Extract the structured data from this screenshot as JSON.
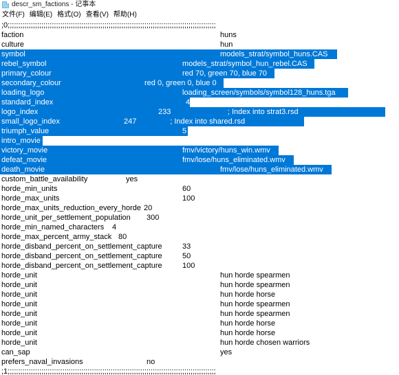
{
  "window": {
    "title": "descr_sm_factions - 记事本",
    "icon": "notepad-icon"
  },
  "menubar": {
    "items": [
      {
        "label": "文件(F)",
        "name": "file"
      },
      {
        "label": "编辑(E)",
        "name": "edit"
      },
      {
        "label": "格式(O)",
        "name": "format"
      },
      {
        "label": "查看(V)",
        "name": "view"
      },
      {
        "label": "帮助(H)",
        "name": "help"
      }
    ]
  },
  "editor": {
    "selection_color": "#0078d7",
    "selection_text_color": "#ffffff",
    "text_color": "#000000",
    "background_color": "#ffffff",
    "lines": [
      {
        "key": ";0;;;;;;;;;;;;;;;;;;;;;;;;;;;;;;;;;;;;;;;;;;;;;;;;;;;;;;;;;;;;;;;;;;;;;;;;;;;;;;;;;;;;;;;;;;;;;;;;;;;",
        "val": "",
        "valx": 0,
        "selected": false,
        "selw": 0,
        "comment": true
      },
      {
        "key": "faction",
        "val": "huns",
        "valx": 320,
        "selected": false,
        "selw": 0
      },
      {
        "key": "culture",
        "val": "hun",
        "valx": 320,
        "selected": false,
        "selw": 0
      },
      {
        "key": "symbol",
        "val": "models_strat/symbol_huns.CAS",
        "valx": 320,
        "selected": true,
        "selw": 490
      },
      {
        "key": "rebel_symbol",
        "val": "models_strat/symbol_hun_rebel.CAS",
        "valx": 265,
        "selected": true,
        "selw": 457
      },
      {
        "key": "primary_colour",
        "val": "red 70, green 70, blue 70",
        "valx": 265,
        "selected": true,
        "selw": 399
      },
      {
        "key": "secondary_colour",
        "val": "red 0, green 0, blue 0",
        "valx": 210,
        "selected": true,
        "selw": 325
      },
      {
        "key": "loading_logo",
        "val": "loading_screen/symbols/symbol128_huns.tga",
        "valx": 265,
        "selected": true,
        "selw": 506
      },
      {
        "key": "standard_index",
        "val": "4",
        "valx": 270,
        "selected": true,
        "selw": 276
      },
      {
        "key": "logo_index",
        "val": "233                           ; Index into strat3.rsd",
        "valx": 230,
        "selected": true,
        "selw": 560
      },
      {
        "key": "small_logo_index",
        "val": "247                ; Index into shared.rsd",
        "valx": 180,
        "selected": true,
        "selw": 442
      },
      {
        "key": "triumph_value",
        "val": "5",
        "valx": 265,
        "selected": true,
        "selw": 273
      },
      {
        "key": "intro_movie",
        "val": "",
        "valx": 0,
        "selected": true,
        "selw": 62
      },
      {
        "key": "victory_movie",
        "val": "fmv/victory/huns_win.wmv",
        "valx": 265,
        "selected": true,
        "selw": 405
      },
      {
        "key": "defeat_movie",
        "val": "fmv/lose/huns_eliminated.wmv",
        "valx": 265,
        "selected": true,
        "selw": 427
      },
      {
        "key": "death_movie",
        "val": "fmv/lose/huns_eliminated.wmv",
        "valx": 320,
        "selected": true,
        "selw": 482
      },
      {
        "key": "custom_battle_availability",
        "val": "yes",
        "valx": 183,
        "selected": false,
        "selw": 0
      },
      {
        "key": "horde_min_units",
        "val": "60",
        "valx": 265,
        "selected": false,
        "selw": 0
      },
      {
        "key": "horde_max_units",
        "val": "100",
        "valx": 265,
        "selected": false,
        "selw": 0
      },
      {
        "key": "horde_max_units_reduction_every_horde",
        "val": "20",
        "valx": 209,
        "selected": false,
        "selw": 0
      },
      {
        "key": "horde_unit_per_settlement_population",
        "val": "300",
        "valx": 213,
        "selected": false,
        "selw": 0
      },
      {
        "key": "horde_min_named_characters",
        "val": "4",
        "valx": 163,
        "selected": false,
        "selw": 0
      },
      {
        "key": "horde_max_percent_army_stack",
        "val": "80",
        "valx": 172,
        "selected": false,
        "selw": 0
      },
      {
        "key": "horde_disband_percent_on_settlement_capture",
        "val": "33",
        "valx": 265,
        "selected": false,
        "selw": 0
      },
      {
        "key": "horde_disband_percent_on_settlement_capture",
        "val": "50",
        "valx": 265,
        "selected": false,
        "selw": 0
      },
      {
        "key": "horde_disband_percent_on_settlement_capture",
        "val": "100",
        "valx": 265,
        "selected": false,
        "selw": 0
      },
      {
        "key": "horde_unit",
        "val": "hun horde spearmen",
        "valx": 320,
        "selected": false,
        "selw": 0
      },
      {
        "key": "horde_unit",
        "val": "hun horde spearmen",
        "valx": 320,
        "selected": false,
        "selw": 0
      },
      {
        "key": "horde_unit",
        "val": "hun horde horse",
        "valx": 320,
        "selected": false,
        "selw": 0
      },
      {
        "key": "horde_unit",
        "val": "hun horde spearmen",
        "valx": 320,
        "selected": false,
        "selw": 0
      },
      {
        "key": "horde_unit",
        "val": "hun horde spearmen",
        "valx": 320,
        "selected": false,
        "selw": 0
      },
      {
        "key": "horde_unit",
        "val": "hun horde horse",
        "valx": 320,
        "selected": false,
        "selw": 0
      },
      {
        "key": "horde_unit",
        "val": "hun horde horse",
        "valx": 320,
        "selected": false,
        "selw": 0
      },
      {
        "key": "horde_unit",
        "val": "hun horde chosen warriors",
        "valx": 320,
        "selected": false,
        "selw": 0
      },
      {
        "key": "can_sap",
        "val": "yes",
        "valx": 320,
        "selected": false,
        "selw": 0
      },
      {
        "key": "prefers_naval_invasions",
        "val": "no",
        "valx": 213,
        "selected": false,
        "selw": 0
      },
      {
        "key": ";1;;;;;;;;;;;;;;;;;;;;;;;;;;;;;;;;;;;;;;;;;;;;;;;;;;;;;;;;;;;;;;;;;;;;;;;;;;;;;;;;;;;;;;;;;;;;;;;;;;;",
        "val": "",
        "valx": 0,
        "selected": false,
        "selw": 0,
        "comment": true
      }
    ]
  }
}
